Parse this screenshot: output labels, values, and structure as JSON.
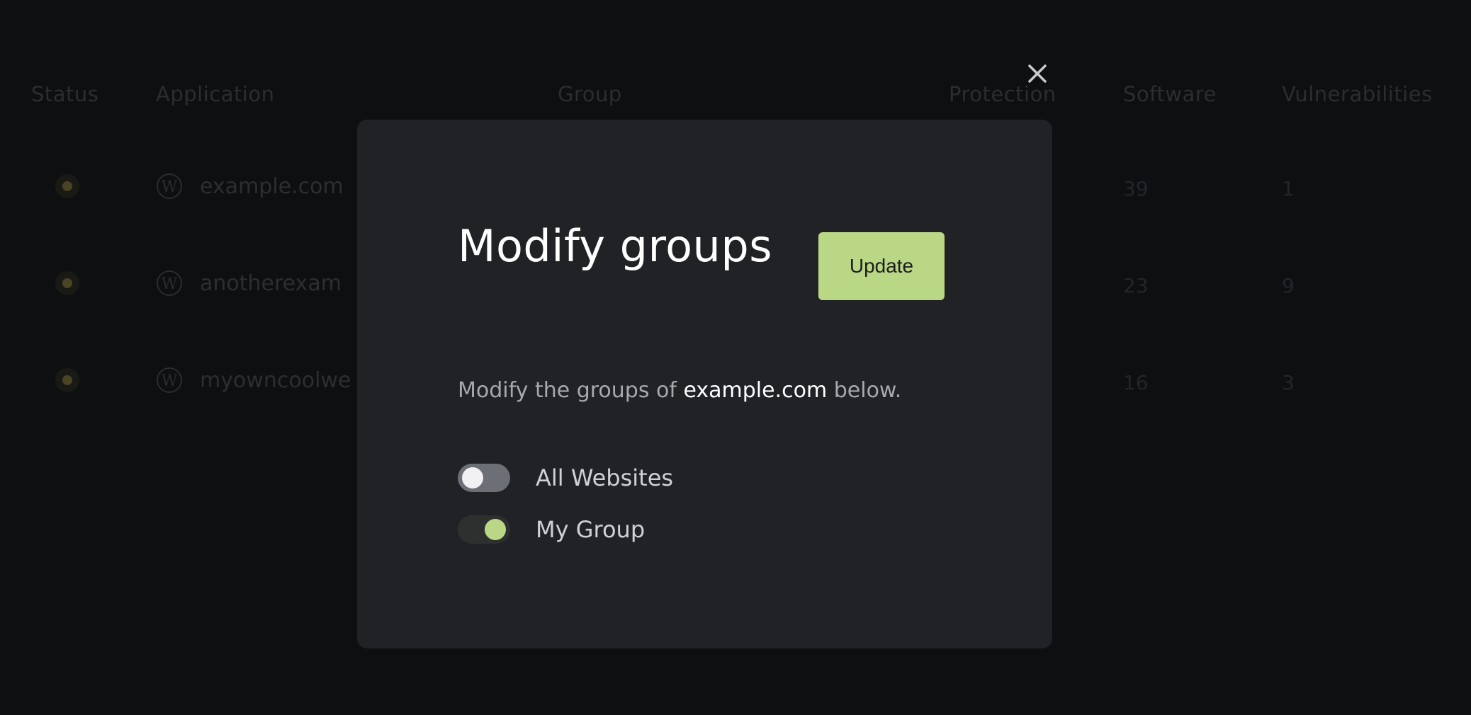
{
  "background_table": {
    "headers": {
      "status": "Status",
      "application": "Application",
      "group": "Group",
      "protection": "Protection",
      "software": "Software",
      "vulnerabilities": "Vulnerabilities"
    },
    "rows": [
      {
        "app": "example.com",
        "software": "39",
        "vulnerabilities": "1"
      },
      {
        "app": "anotherexam",
        "software": "23",
        "vulnerabilities": "9"
      },
      {
        "app": "myowncoolwe",
        "software": "16",
        "vulnerabilities": "3"
      }
    ]
  },
  "modal": {
    "title": "Modify groups",
    "update_label": "Update",
    "description_prefix": "Modify the groups of ",
    "description_site": "example.com",
    "description_suffix": " below.",
    "groups": [
      {
        "label": "All Websites",
        "enabled": false
      },
      {
        "label": "My Group",
        "enabled": true
      }
    ],
    "close_icon": "close-icon"
  },
  "colors": {
    "accent": "#bad785",
    "modal_bg": "#212226",
    "page_bg": "#0e0f11"
  }
}
